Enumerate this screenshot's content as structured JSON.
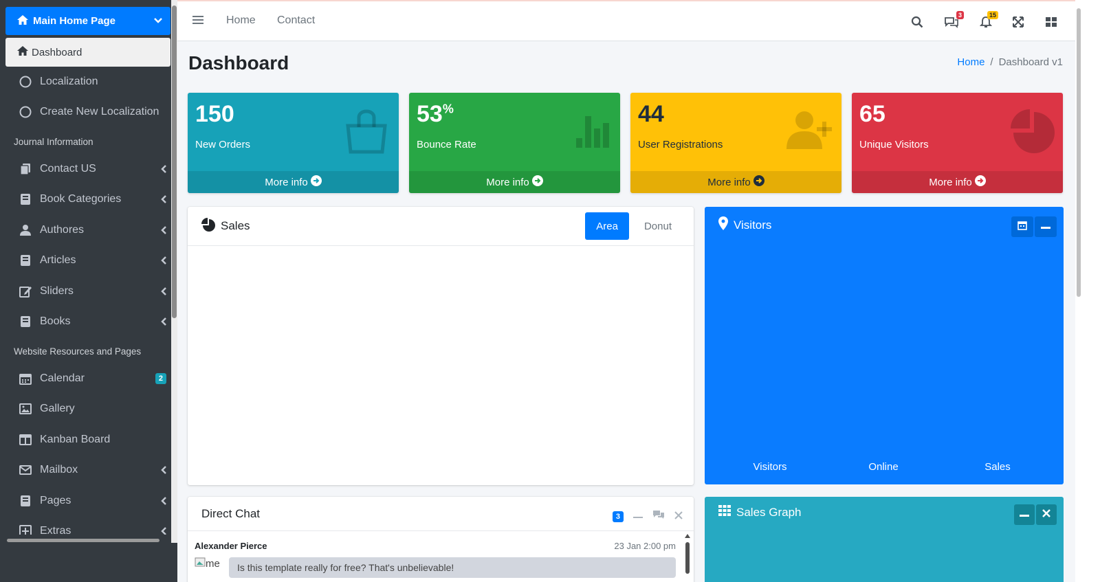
{
  "sidebar": {
    "brand": "Main Home Page",
    "active": "Dashboard",
    "items_top": [
      "Localization",
      "Create New Localization"
    ],
    "header_journal": "Journal Information",
    "journal_items": [
      "Contact US",
      "Book Categories",
      "Authores",
      "Articles",
      "Sliders",
      "Books"
    ],
    "header_website": "Website Resources and Pages",
    "website_items": [
      "Calendar",
      "Gallery",
      "Kanban Board",
      "Mailbox",
      "Pages",
      "Extras"
    ],
    "calendar_badge": "2"
  },
  "navbar": {
    "links": [
      "Home",
      "Contact"
    ],
    "messages_badge": "3",
    "notifications_badge": "15"
  },
  "page": {
    "title": "Dashboard",
    "breadcrumb": [
      "Home",
      "Dashboard v1"
    ]
  },
  "stats": [
    {
      "value": "150",
      "suffix": "",
      "label": "New Orders",
      "link": "More info",
      "color": "#17a2b8"
    },
    {
      "value": "53",
      "suffix": "%",
      "label": "Bounce Rate",
      "link": "More info",
      "color": "#28a745"
    },
    {
      "value": "44",
      "suffix": "",
      "label": "User Registrations",
      "link": "More info",
      "color": "#ffc107"
    },
    {
      "value": "65",
      "suffix": "",
      "label": "Unique Visitors",
      "link": "More info",
      "color": "#dc3545"
    }
  ],
  "sales": {
    "title": "Sales",
    "tabs": [
      "Area",
      "Donut"
    ],
    "active_tab": "Area"
  },
  "visitors": {
    "title": "Visitors",
    "footer": [
      "Visitors",
      "Online",
      "Sales"
    ],
    "color": "#0a7cff"
  },
  "chat": {
    "title": "Direct Chat",
    "badge": "3",
    "message": {
      "name": "Alexander Pierce",
      "time": "23 Jan 2:00 pm",
      "img_alt": "me",
      "text": "Is this template really for free? That's unbelievable!"
    }
  },
  "sales_graph": {
    "title": "Sales Graph",
    "color": "#26a9c2"
  }
}
